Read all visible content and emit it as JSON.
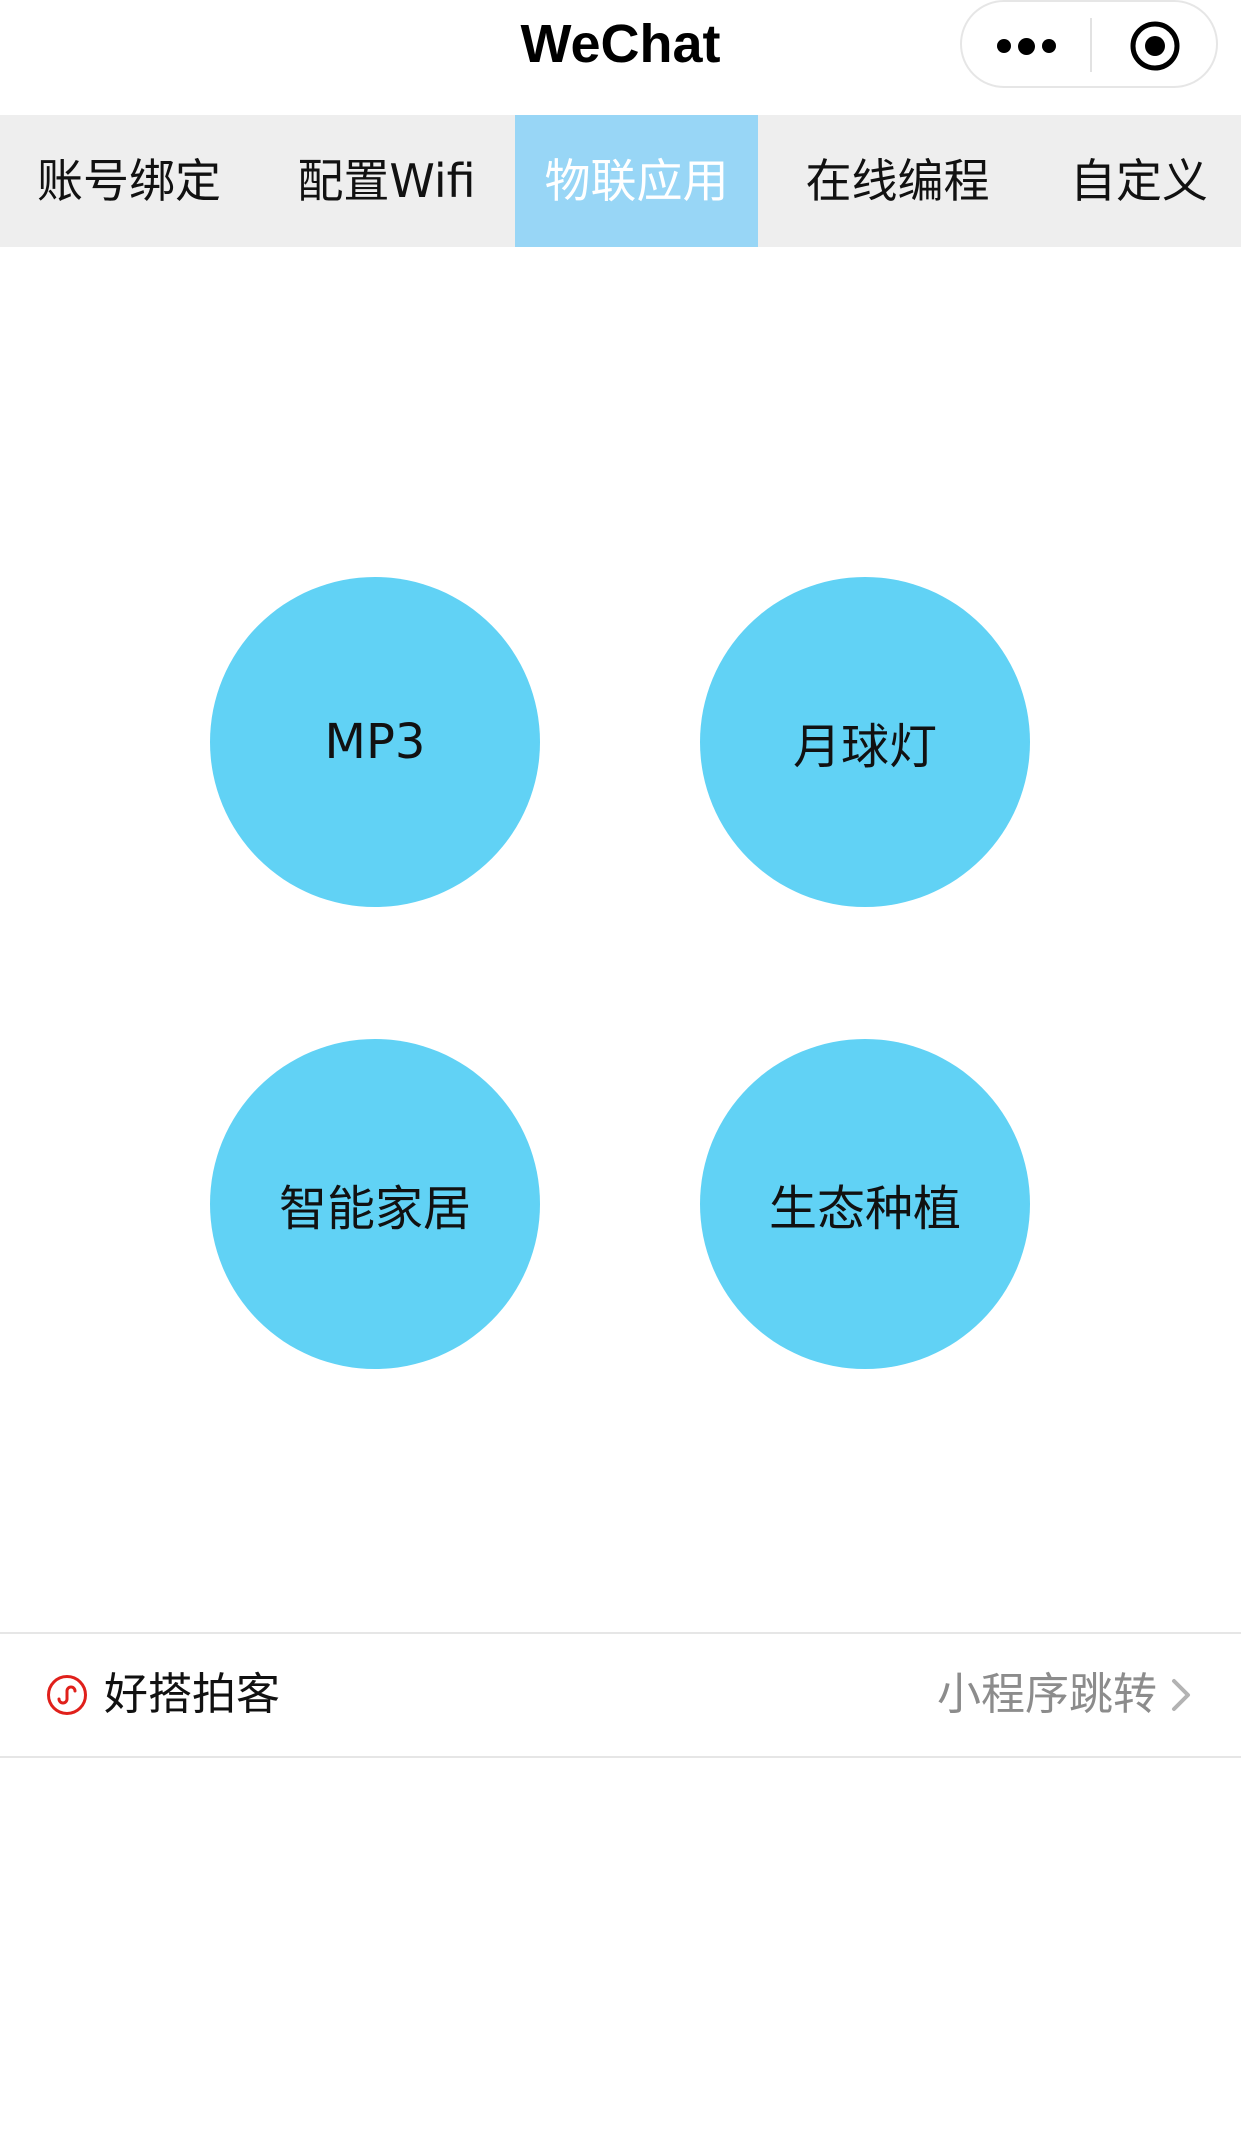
{
  "navbar": {
    "title": "WeChat",
    "more_icon": "more-dots-icon",
    "close_icon": "target-circle-icon"
  },
  "tabs": [
    {
      "label": "账号绑定",
      "active": false
    },
    {
      "label": "配置Wifi",
      "active": false
    },
    {
      "label": "物联应用",
      "active": true
    },
    {
      "label": "在线编程",
      "active": false
    },
    {
      "label": "自定义",
      "active": false
    }
  ],
  "apps": [
    {
      "label": "MP3"
    },
    {
      "label": "月球灯"
    },
    {
      "label": "智能家居"
    },
    {
      "label": "生态种植"
    }
  ],
  "footer": {
    "app_name": "好搭拍客",
    "action_label": "小程序跳转",
    "app_icon": "mini-program-icon",
    "chevron_icon": "chevron-right-icon"
  },
  "colors": {
    "tab_bar_bg": "#eeeeee",
    "tab_active_bg": "#98d6f6",
    "circle_bg": "#61d2f5",
    "mini_program_icon": "#e0201b"
  }
}
